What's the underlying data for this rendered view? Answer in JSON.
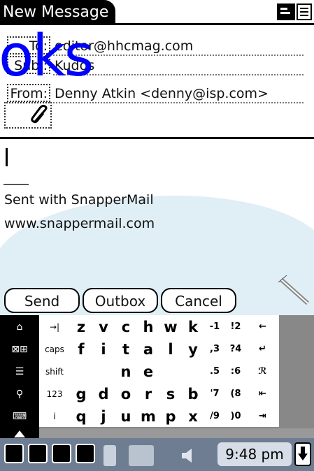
{
  "window": {
    "title": "New Message"
  },
  "header": {
    "to_label": "To:",
    "to_value": "editor@hhcmag.com",
    "subject_label": "Subj:",
    "subject_value": "Kudos",
    "from_label": "From:",
    "from_value": "Denny Atkin <denny@isp.com>"
  },
  "watermark": "oks",
  "body": {
    "signature_line1": "Sent with SnapperMail",
    "signature_line2": "www.snappermail.com"
  },
  "buttons": {
    "send": "Send",
    "outbox": "Outbox",
    "cancel": "Cancel"
  },
  "keyboard": {
    "side_keys": [
      {
        "icon": "home-icon",
        "label": "⌂"
      },
      {
        "icon": "app-switch-icon",
        "label": "⊠⊞"
      },
      {
        "icon": "menu-icon",
        "label": "☰"
      },
      {
        "icon": "find-icon",
        "label": "⚲"
      },
      {
        "icon": "keyboard-icon",
        "label": "⌨"
      }
    ],
    "rows": [
      [
        "→|",
        "z",
        "v",
        "c",
        "h",
        "w",
        "k",
        "-1",
        "!2",
        "←"
      ],
      [
        "caps",
        "f",
        "i",
        "t",
        "a",
        "l",
        "y",
        ",3",
        "?4",
        "↵"
      ],
      [
        "shift",
        "",
        "",
        "n",
        "e",
        "",
        "",
        ".5",
        ":6",
        "ℛ"
      ],
      [
        "123",
        "g",
        "d",
        "o",
        "r",
        "s",
        "b",
        "'7",
        "(8",
        "⇤"
      ],
      [
        "i",
        "q",
        "j",
        "u",
        "m",
        "p",
        "x",
        "/9",
        ")0",
        "⇥"
      ]
    ]
  },
  "status": {
    "time": "9:48 pm"
  }
}
